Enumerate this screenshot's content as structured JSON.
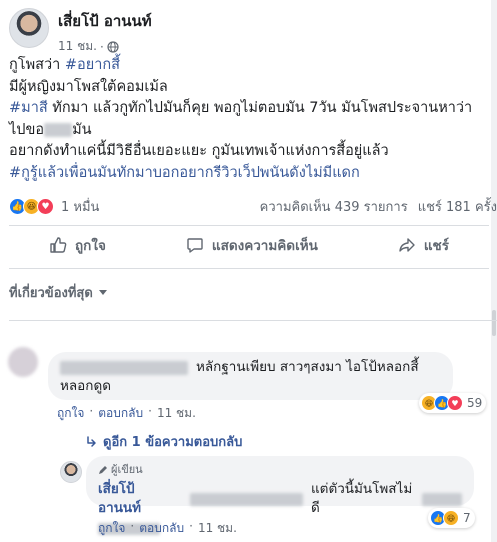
{
  "post": {
    "author": "เสี่ยโป้ อานนท์",
    "time": "11 ชม.",
    "line1_a": "กูโพสว่า ",
    "line1_tag": "#อยากสี้",
    "line2": "มีผู้หญิงมาโพสใต้คอมเม้ล",
    "line3_tag": "#มาสี",
    "line3_b": " ทักมา แล้วกูทักไปมันก็คุย พอกูไม่ตอบมัน 7วัน มันโพสประจานหาว่า",
    "line4_a": "ไปขอ",
    "line4_b": "มัน",
    "line5": "อยากดังทำแค่นี้มีวิธีอื่นเยอะแยะ กูมันเทพเจ้าแห่งการสี้อยู่แล้ว",
    "line6_tag": "#กูรู้แล้วเพื่อนมันทักมาบอกอยากรีวิวเว็ปพนันดังไม่มีแดก"
  },
  "stats": {
    "reactions": "1 หมื่น",
    "comments": "ความคิดเห็น 439 รายการ",
    "shares": "แชร์ 181 ครั้ง"
  },
  "actions": {
    "like": "ถูกใจ",
    "comment": "แสดงความคิดเห็น",
    "share": "แชร์"
  },
  "filter": {
    "label": "ที่เกี่ยวข้องที่สุด"
  },
  "comments": [
    {
      "text_a": "หลักฐานเพียบ สาวๆสงมา ไอโป้หลอกสี้",
      "text_b": "หลอกดูด",
      "like": "ถูกใจ",
      "reply": "ตอบกลับ",
      "time": "11 ชม.",
      "reaction_count": "59"
    }
  ],
  "replies_link": "ดูอีก 1 ข้อความตอบกลับ",
  "reply": {
    "badge": "ผู้เขียน",
    "author": "เสี่ยโป้ อานนท์",
    "text_a": "แต่ตัวนี้มันโพสไม่ดี",
    "like": "ถูกใจ",
    "reply": "ตอบกลับ",
    "time": "11 ชม.",
    "reaction_count": "7"
  },
  "separator": "·",
  "icons": {
    "globe": "globe-icon",
    "like": "thumbs-up-icon",
    "comment": "speech-bubble-icon",
    "share": "share-arrow-icon",
    "reply_arrow": "reply-arrow-icon",
    "author_badge": "pen-icon"
  },
  "colors": {
    "link_blue": "#385898",
    "like_blue": "#1877f2",
    "haha_yellow": "#f7b125",
    "love_red": "#f33e58",
    "secondary_text": "#606770",
    "bubble_bg": "#f2f3f5"
  }
}
